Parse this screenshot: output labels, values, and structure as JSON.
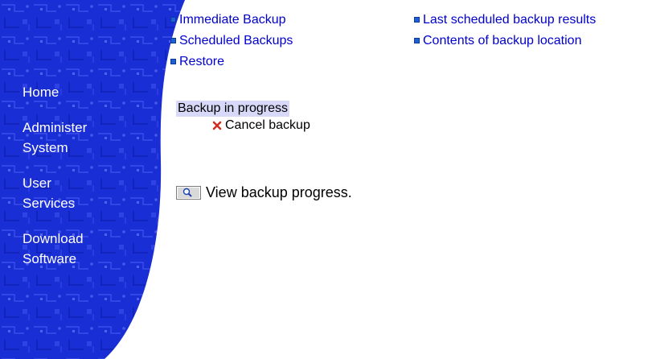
{
  "sidebar": {
    "items": [
      {
        "lines": [
          "Home"
        ]
      },
      {
        "lines": [
          "Administer",
          "System"
        ]
      },
      {
        "lines": [
          "User",
          "Services"
        ]
      },
      {
        "lines": [
          "Download",
          "Software"
        ]
      }
    ],
    "colors": {
      "background": "#1a2ed8",
      "dark": "#0b1a9e",
      "light": "#3f52ff"
    }
  },
  "links": {
    "col1": [
      "Immediate Backup",
      "Scheduled Backups",
      "Restore"
    ],
    "col2": [
      "Last scheduled backup results",
      "Contents of backup location"
    ],
    "color": "#0000cc"
  },
  "status": {
    "title": "Backup in progress",
    "cancel_label": "Cancel backup",
    "highlight_color": "#d8d8f8"
  },
  "progress": {
    "label": "View backup progress."
  },
  "icons": {
    "bullet": "square-bullet-icon",
    "cancel": "red-x-icon",
    "progress": "magnifier-icon"
  }
}
